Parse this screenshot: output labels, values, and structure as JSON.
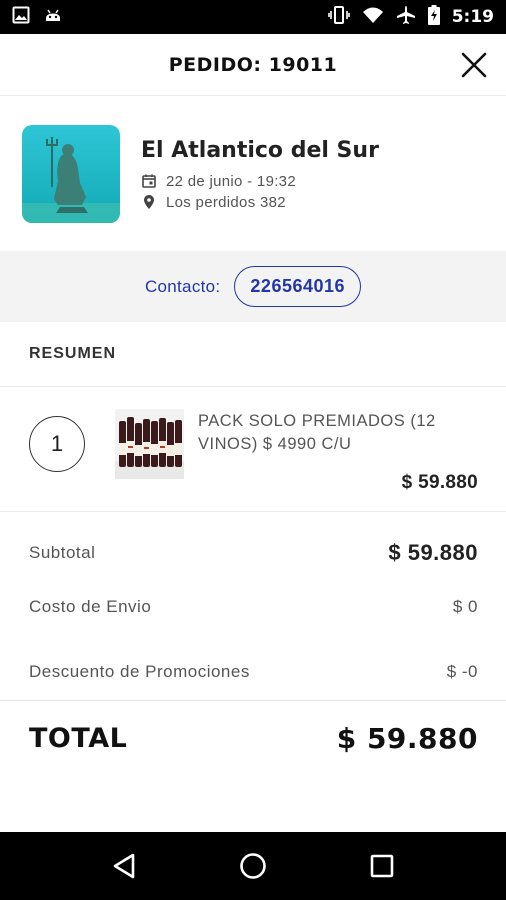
{
  "status_bar": {
    "time": "5:19",
    "icons": [
      "image-icon",
      "android-icon",
      "vibrate-icon",
      "wifi-icon",
      "airplane-icon",
      "battery-charging-icon"
    ]
  },
  "header": {
    "title": "PEDIDO: 19011",
    "close_icon": "close-icon"
  },
  "store": {
    "name": "El Atlantico del Sur",
    "datetime": "22 de junio - 19:32",
    "address": "Los perdidos 382",
    "calendar_icon": "calendar-icon",
    "location_icon": "location-pin-icon"
  },
  "contact": {
    "label": "Contacto:",
    "phone": "226564016"
  },
  "summary": {
    "section_title": "RESUMEN",
    "items": [
      {
        "quantity": "1",
        "description": "PACK SOLO PREMIADOS (12 VINOS) $ 4990 C/U",
        "price": "$ 59.880"
      }
    ]
  },
  "totals": {
    "subtotal_label": "Subtotal",
    "subtotal_value": "$ 59.880",
    "shipping_label": "Costo de Envio",
    "shipping_value": "$ 0",
    "discount_label": "Descuento de Promociones",
    "discount_value": "$ -0",
    "total_label": "TOTAL",
    "total_value": "$ 59.880"
  },
  "nav_bar": {
    "icons": [
      "back-icon",
      "home-icon",
      "recents-icon"
    ]
  },
  "colors": {
    "accent": "#2236a8",
    "band": "#f3f3f3",
    "text": "#222222"
  }
}
